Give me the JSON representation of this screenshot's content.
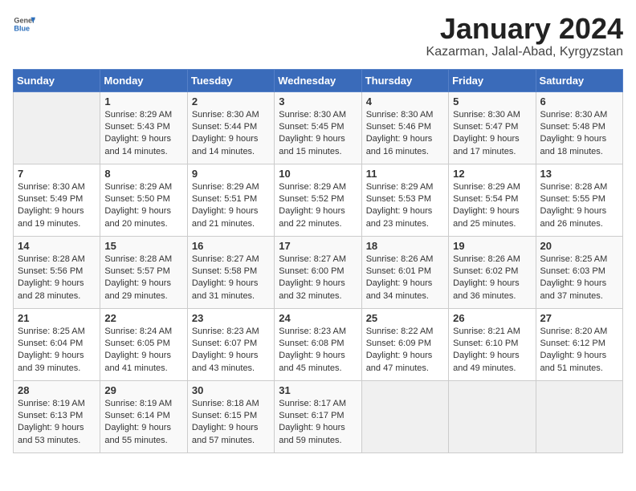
{
  "logo": {
    "general": "General",
    "blue": "Blue"
  },
  "title": "January 2024",
  "subtitle": "Kazarman, Jalal-Abad, Kyrgyzstan",
  "days_of_week": [
    "Sunday",
    "Monday",
    "Tuesday",
    "Wednesday",
    "Thursday",
    "Friday",
    "Saturday"
  ],
  "weeks": [
    [
      {
        "day": "",
        "sunrise": "",
        "sunset": "",
        "daylight": ""
      },
      {
        "day": "1",
        "sunrise": "Sunrise: 8:29 AM",
        "sunset": "Sunset: 5:43 PM",
        "daylight": "Daylight: 9 hours",
        "daylight2": "and 14 minutes."
      },
      {
        "day": "2",
        "sunrise": "Sunrise: 8:30 AM",
        "sunset": "Sunset: 5:44 PM",
        "daylight": "Daylight: 9 hours",
        "daylight2": "and 14 minutes."
      },
      {
        "day": "3",
        "sunrise": "Sunrise: 8:30 AM",
        "sunset": "Sunset: 5:45 PM",
        "daylight": "Daylight: 9 hours",
        "daylight2": "and 15 minutes."
      },
      {
        "day": "4",
        "sunrise": "Sunrise: 8:30 AM",
        "sunset": "Sunset: 5:46 PM",
        "daylight": "Daylight: 9 hours",
        "daylight2": "and 16 minutes."
      },
      {
        "day": "5",
        "sunrise": "Sunrise: 8:30 AM",
        "sunset": "Sunset: 5:47 PM",
        "daylight": "Daylight: 9 hours",
        "daylight2": "and 17 minutes."
      },
      {
        "day": "6",
        "sunrise": "Sunrise: 8:30 AM",
        "sunset": "Sunset: 5:48 PM",
        "daylight": "Daylight: 9 hours",
        "daylight2": "and 18 minutes."
      }
    ],
    [
      {
        "day": "7",
        "sunrise": "Sunrise: 8:30 AM",
        "sunset": "Sunset: 5:49 PM",
        "daylight": "Daylight: 9 hours",
        "daylight2": "and 19 minutes."
      },
      {
        "day": "8",
        "sunrise": "Sunrise: 8:29 AM",
        "sunset": "Sunset: 5:50 PM",
        "daylight": "Daylight: 9 hours",
        "daylight2": "and 20 minutes."
      },
      {
        "day": "9",
        "sunrise": "Sunrise: 8:29 AM",
        "sunset": "Sunset: 5:51 PM",
        "daylight": "Daylight: 9 hours",
        "daylight2": "and 21 minutes."
      },
      {
        "day": "10",
        "sunrise": "Sunrise: 8:29 AM",
        "sunset": "Sunset: 5:52 PM",
        "daylight": "Daylight: 9 hours",
        "daylight2": "and 22 minutes."
      },
      {
        "day": "11",
        "sunrise": "Sunrise: 8:29 AM",
        "sunset": "Sunset: 5:53 PM",
        "daylight": "Daylight: 9 hours",
        "daylight2": "and 23 minutes."
      },
      {
        "day": "12",
        "sunrise": "Sunrise: 8:29 AM",
        "sunset": "Sunset: 5:54 PM",
        "daylight": "Daylight: 9 hours",
        "daylight2": "and 25 minutes."
      },
      {
        "day": "13",
        "sunrise": "Sunrise: 8:28 AM",
        "sunset": "Sunset: 5:55 PM",
        "daylight": "Daylight: 9 hours",
        "daylight2": "and 26 minutes."
      }
    ],
    [
      {
        "day": "14",
        "sunrise": "Sunrise: 8:28 AM",
        "sunset": "Sunset: 5:56 PM",
        "daylight": "Daylight: 9 hours",
        "daylight2": "and 28 minutes."
      },
      {
        "day": "15",
        "sunrise": "Sunrise: 8:28 AM",
        "sunset": "Sunset: 5:57 PM",
        "daylight": "Daylight: 9 hours",
        "daylight2": "and 29 minutes."
      },
      {
        "day": "16",
        "sunrise": "Sunrise: 8:27 AM",
        "sunset": "Sunset: 5:58 PM",
        "daylight": "Daylight: 9 hours",
        "daylight2": "and 31 minutes."
      },
      {
        "day": "17",
        "sunrise": "Sunrise: 8:27 AM",
        "sunset": "Sunset: 6:00 PM",
        "daylight": "Daylight: 9 hours",
        "daylight2": "and 32 minutes."
      },
      {
        "day": "18",
        "sunrise": "Sunrise: 8:26 AM",
        "sunset": "Sunset: 6:01 PM",
        "daylight": "Daylight: 9 hours",
        "daylight2": "and 34 minutes."
      },
      {
        "day": "19",
        "sunrise": "Sunrise: 8:26 AM",
        "sunset": "Sunset: 6:02 PM",
        "daylight": "Daylight: 9 hours",
        "daylight2": "and 36 minutes."
      },
      {
        "day": "20",
        "sunrise": "Sunrise: 8:25 AM",
        "sunset": "Sunset: 6:03 PM",
        "daylight": "Daylight: 9 hours",
        "daylight2": "and 37 minutes."
      }
    ],
    [
      {
        "day": "21",
        "sunrise": "Sunrise: 8:25 AM",
        "sunset": "Sunset: 6:04 PM",
        "daylight": "Daylight: 9 hours",
        "daylight2": "and 39 minutes."
      },
      {
        "day": "22",
        "sunrise": "Sunrise: 8:24 AM",
        "sunset": "Sunset: 6:05 PM",
        "daylight": "Daylight: 9 hours",
        "daylight2": "and 41 minutes."
      },
      {
        "day": "23",
        "sunrise": "Sunrise: 8:23 AM",
        "sunset": "Sunset: 6:07 PM",
        "daylight": "Daylight: 9 hours",
        "daylight2": "and 43 minutes."
      },
      {
        "day": "24",
        "sunrise": "Sunrise: 8:23 AM",
        "sunset": "Sunset: 6:08 PM",
        "daylight": "Daylight: 9 hours",
        "daylight2": "and 45 minutes."
      },
      {
        "day": "25",
        "sunrise": "Sunrise: 8:22 AM",
        "sunset": "Sunset: 6:09 PM",
        "daylight": "Daylight: 9 hours",
        "daylight2": "and 47 minutes."
      },
      {
        "day": "26",
        "sunrise": "Sunrise: 8:21 AM",
        "sunset": "Sunset: 6:10 PM",
        "daylight": "Daylight: 9 hours",
        "daylight2": "and 49 minutes."
      },
      {
        "day": "27",
        "sunrise": "Sunrise: 8:20 AM",
        "sunset": "Sunset: 6:12 PM",
        "daylight": "Daylight: 9 hours",
        "daylight2": "and 51 minutes."
      }
    ],
    [
      {
        "day": "28",
        "sunrise": "Sunrise: 8:19 AM",
        "sunset": "Sunset: 6:13 PM",
        "daylight": "Daylight: 9 hours",
        "daylight2": "and 53 minutes."
      },
      {
        "day": "29",
        "sunrise": "Sunrise: 8:19 AM",
        "sunset": "Sunset: 6:14 PM",
        "daylight": "Daylight: 9 hours",
        "daylight2": "and 55 minutes."
      },
      {
        "day": "30",
        "sunrise": "Sunrise: 8:18 AM",
        "sunset": "Sunset: 6:15 PM",
        "daylight": "Daylight: 9 hours",
        "daylight2": "and 57 minutes."
      },
      {
        "day": "31",
        "sunrise": "Sunrise: 8:17 AM",
        "sunset": "Sunset: 6:17 PM",
        "daylight": "Daylight: 9 hours",
        "daylight2": "and 59 minutes."
      },
      {
        "day": "",
        "sunrise": "",
        "sunset": "",
        "daylight": ""
      },
      {
        "day": "",
        "sunrise": "",
        "sunset": "",
        "daylight": ""
      },
      {
        "day": "",
        "sunrise": "",
        "sunset": "",
        "daylight": ""
      }
    ]
  ]
}
